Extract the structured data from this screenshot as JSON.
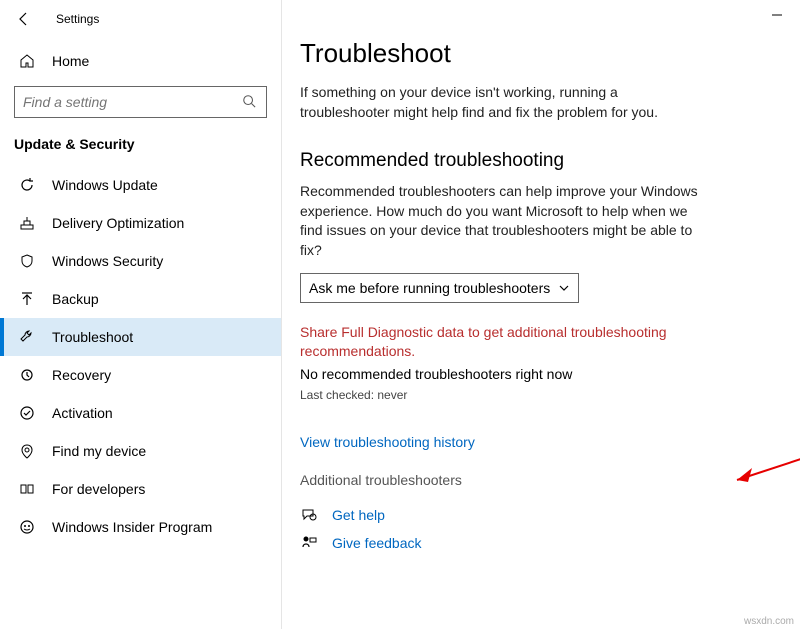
{
  "title": "Settings",
  "home_label": "Home",
  "search_placeholder": "Find a setting",
  "section_title": "Update & Security",
  "nav": [
    {
      "label": "Windows Update"
    },
    {
      "label": "Delivery Optimization"
    },
    {
      "label": "Windows Security"
    },
    {
      "label": "Backup"
    },
    {
      "label": "Troubleshoot"
    },
    {
      "label": "Recovery"
    },
    {
      "label": "Activation"
    },
    {
      "label": "Find my device"
    },
    {
      "label": "For developers"
    },
    {
      "label": "Windows Insider Program"
    }
  ],
  "page": {
    "title": "Troubleshoot",
    "intro": "If something on your device isn't working, running a troubleshooter might help find and fix the problem for you.",
    "recommended_title": "Recommended troubleshooting",
    "recommended_desc": "Recommended troubleshooters can help improve your Windows experience. How much do you want Microsoft to help when we find issues on your device that troubleshooters might be able to fix?",
    "dropdown_value": "Ask me before running troubleshooters",
    "warning_link": "Share Full Diagnostic data to get additional troubleshooting recommendations.",
    "no_rec": "No recommended troubleshooters right now",
    "last_checked": "Last checked: never",
    "history_link": "View troubleshooting history",
    "additional": "Additional troubleshooters",
    "get_help": "Get help",
    "give_feedback": "Give feedback"
  },
  "watermark": "wsxdn.com"
}
